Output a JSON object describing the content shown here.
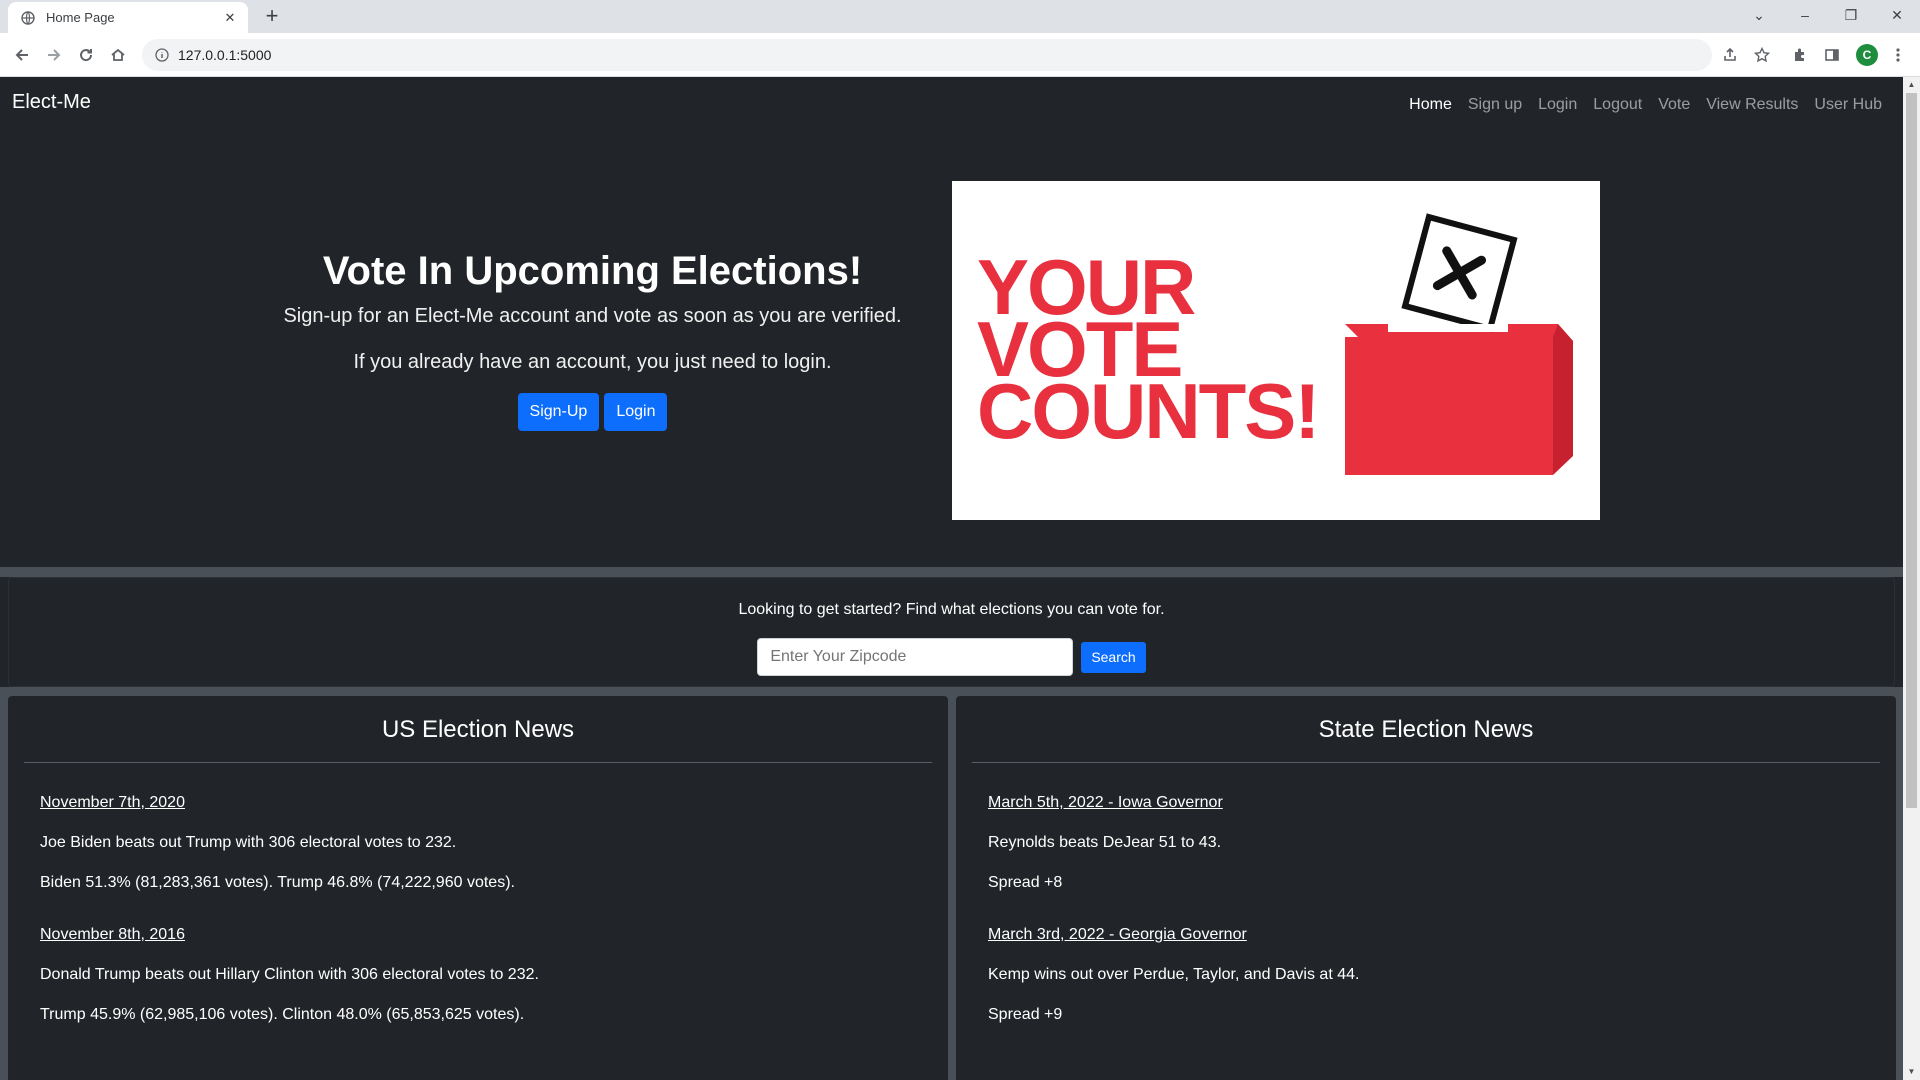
{
  "browser": {
    "tab_title": "Home Page",
    "url": "127.0.0.1:5000",
    "profile_initial": "C"
  },
  "nav": {
    "brand": "Elect-Me",
    "links": [
      "Home",
      "Sign up",
      "Login",
      "Logout",
      "Vote",
      "View Results",
      "User Hub"
    ],
    "active": "Home"
  },
  "hero": {
    "title": "Vote In Upcoming Elections!",
    "line1": "Sign-up for an Elect-Me account and vote as soon as you are verified.",
    "line2": "If you already have an account, you just need to login.",
    "signup_label": "Sign-Up",
    "login_label": "Login",
    "image_text": [
      "YOUR",
      "VOTE",
      "COUNTS!"
    ]
  },
  "search": {
    "prompt": "Looking to get started? Find what elections you can vote for.",
    "placeholder": "Enter Your Zipcode",
    "button_label": "Search"
  },
  "us_news": {
    "heading": "US Election News",
    "items": [
      {
        "date": "November 7th, 2020",
        "lines": [
          "Joe Biden beats out Trump with 306 electoral votes to 232.",
          "Biden 51.3% (81,283,361 votes). Trump 46.8% (74,222,960 votes)."
        ]
      },
      {
        "date": "November 8th, 2016",
        "lines": [
          "Donald Trump beats out Hillary Clinton with 306 electoral votes to 232.",
          "Trump 45.9% (62,985,106 votes). Clinton 48.0% (65,853,625 votes)."
        ]
      }
    ]
  },
  "state_news": {
    "heading": "State Election News",
    "items": [
      {
        "date": "March 5th, 2022 - Iowa Governor",
        "lines": [
          "Reynolds beats DeJear 51 to 43.",
          "Spread +8"
        ]
      },
      {
        "date": "March 3rd, 2022 - Georgia Governor",
        "lines": [
          "Kemp wins out over Perdue, Taylor, and Davis at 44.",
          "Spread +9"
        ]
      }
    ]
  },
  "colors": {
    "page_bg": "#212529",
    "accent": "#0d6efd",
    "image_red": "#e8303f"
  }
}
